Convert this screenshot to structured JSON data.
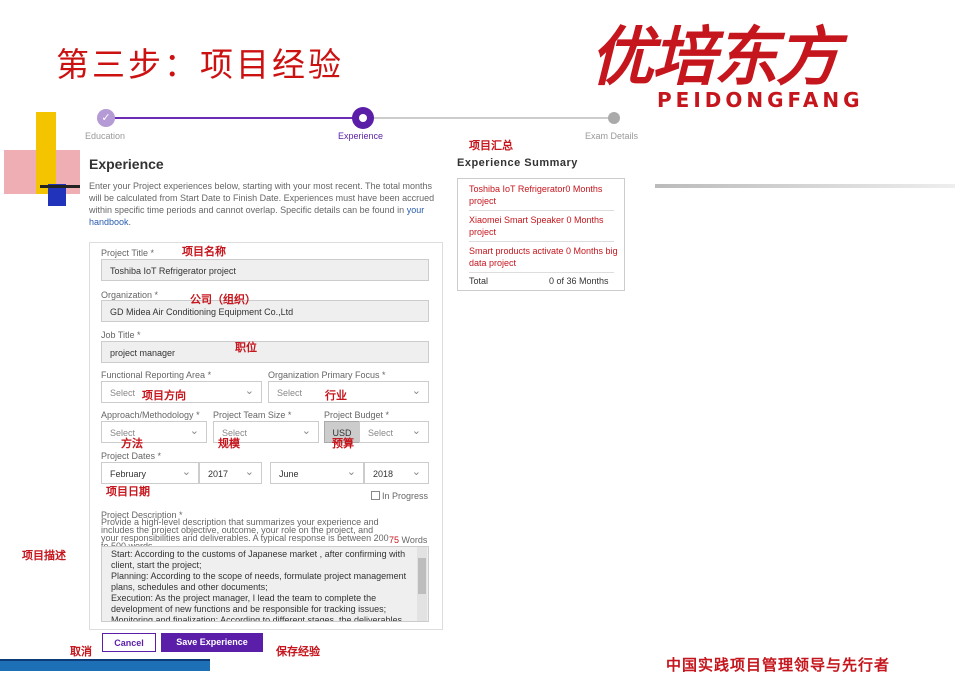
{
  "slide_title": "第三步：项目经验",
  "logo": {
    "cn": "优培东方",
    "en": "PEIDONGFANG"
  },
  "footer_text": "中国实践项目管理领导与先行者",
  "steps": [
    {
      "label": "Education",
      "state": "done"
    },
    {
      "label": "Experience",
      "state": "current"
    },
    {
      "label": "Exam Details",
      "state": "pending"
    }
  ],
  "experience": {
    "heading": "Experience",
    "intro": "Enter your Project experiences below, starting with your most recent. The total months will be calculated from Start Date to Finish Date. Experiences must have been accrued within specific time periods and cannot overlap. Specific details can be found in",
    "handbook_link": "your handbook",
    "intro_end": "."
  },
  "form": {
    "project_title": {
      "label": "Project Title *",
      "value": "Toshiba IoT Refrigerator project"
    },
    "organization": {
      "label": "Organization *",
      "value": "GD Midea Air Conditioning Equipment Co.,Ltd"
    },
    "job_title": {
      "label": "Job Title *",
      "value": "project manager"
    },
    "functional_area": {
      "label": "Functional Reporting Area *",
      "value": "Select"
    },
    "primary_focus": {
      "label": "Organization Primary Focus *",
      "value": "Select"
    },
    "approach": {
      "label": "Approach/Methodology *",
      "value": "Select"
    },
    "team_size": {
      "label": "Project Team Size *",
      "value": "Select"
    },
    "budget": {
      "label": "Project Budget *",
      "currency": "USD",
      "value": "Select"
    },
    "dates": {
      "label": "Project Dates *",
      "start_month": "February",
      "start_year": "2017",
      "end_month": "June",
      "end_year": "2018",
      "in_progress_label": "In Progress"
    },
    "description": {
      "label": "Project Description *",
      "help": "Provide a high-level description that summarizes your experience and includes the project objective, outcome, your role on the project, and your responsibilities and deliverables. A typical response is between 200 to 500 words.",
      "word_count": "75",
      "word_suffix": "Words",
      "text": "Start: According to the customs of Japanese market , after confirming with client, start the project;\nPlanning: According to the scope of needs, formulate project management plans, schedules and other documents;\nExecution: As the project manager, I lead the team to complete the development of new functions and be responsible for tracking issues;\nMonitoring and finalization: According to different stages, the deliverables are checked. The project passed the acceptance and"
    },
    "cancel_label": "Cancel",
    "save_label": "Save Experience"
  },
  "summary": {
    "title": "Experience Summary",
    "items": [
      "Toshiba IoT Refrigerator0 Months project",
      "Xiaomei Smart Speaker 0 Months project",
      "Smart products activate 0 Months big data project"
    ],
    "total_label": "Total",
    "total_value": "0 of 36 Months"
  },
  "annotations": {
    "summary": "项目汇总",
    "project_name": "项目名称",
    "company": "公司（组织）",
    "job": "职位",
    "direction": "项目方向",
    "industry": "行业",
    "method": "方法",
    "scale": "规模",
    "budget": "预算",
    "dates": "项目日期",
    "description": "项目描述",
    "cancel": "取消",
    "save": "保存经验"
  },
  "colors": {
    "accent": "#5a1ea8",
    "brand_red": "#c5161d",
    "annotation_red": "#c5161d"
  }
}
